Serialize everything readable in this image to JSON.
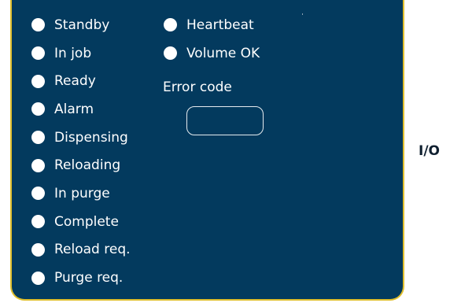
{
  "panel": {
    "left_column": [
      {
        "label": "Standby",
        "icon": "status-dot-icon"
      },
      {
        "label": "In job",
        "icon": "status-dot-icon"
      },
      {
        "label": "Ready",
        "icon": "status-dot-icon"
      },
      {
        "label": "Alarm",
        "icon": "status-dot-icon"
      },
      {
        "label": "Dispensing",
        "icon": "status-dot-icon"
      },
      {
        "label": "Reloading",
        "icon": "status-dot-icon"
      },
      {
        "label": "In purge",
        "icon": "status-dot-icon"
      },
      {
        "label": "Complete",
        "icon": "status-dot-icon"
      },
      {
        "label": "Reload req.",
        "icon": "status-dot-icon"
      },
      {
        "label": "Purge req.",
        "icon": "status-dot-icon"
      }
    ],
    "right_column": [
      {
        "label": "Heartbeat",
        "icon": "status-dot-icon"
      },
      {
        "label": "Volume OK",
        "icon": "status-dot-icon"
      }
    ],
    "error_code": {
      "label": "Error code",
      "value": ""
    }
  },
  "side_label": "I/O",
  "colors": {
    "panel_background": "#033a5e",
    "panel_border": "#e0bf2d",
    "indicator_off": "#ffffff",
    "text": "#ffffff"
  }
}
